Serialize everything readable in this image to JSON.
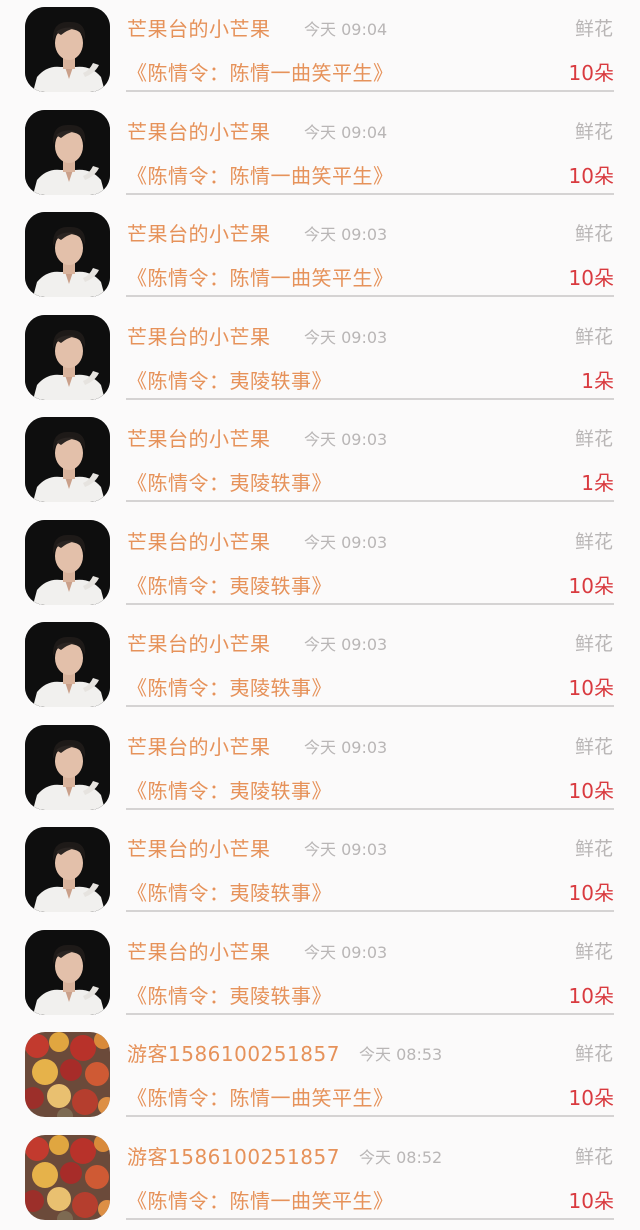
{
  "gift_records": [
    {
      "user": "芒果台的小芒果",
      "time": "今天 09:04",
      "gift": "鲜花",
      "show": "《陈情令：陈情一曲笑平生》",
      "count": "10朵",
      "avatar": "star-portrait-icon"
    },
    {
      "user": "芒果台的小芒果",
      "time": "今天 09:04",
      "gift": "鲜花",
      "show": "《陈情令：陈情一曲笑平生》",
      "count": "10朵",
      "avatar": "star-portrait-icon"
    },
    {
      "user": "芒果台的小芒果",
      "time": "今天 09:03",
      "gift": "鲜花",
      "show": "《陈情令：陈情一曲笑平生》",
      "count": "10朵",
      "avatar": "star-portrait-icon"
    },
    {
      "user": "芒果台的小芒果",
      "time": "今天 09:03",
      "gift": "鲜花",
      "show": "《陈情令：夷陵轶事》",
      "count": "1朵",
      "avatar": "star-portrait-icon"
    },
    {
      "user": "芒果台的小芒果",
      "time": "今天 09:03",
      "gift": "鲜花",
      "show": "《陈情令：夷陵轶事》",
      "count": "1朵",
      "avatar": "star-portrait-icon"
    },
    {
      "user": "芒果台的小芒果",
      "time": "今天 09:03",
      "gift": "鲜花",
      "show": "《陈情令：夷陵轶事》",
      "count": "10朵",
      "avatar": "star-portrait-icon"
    },
    {
      "user": "芒果台的小芒果",
      "time": "今天 09:03",
      "gift": "鲜花",
      "show": "《陈情令：夷陵轶事》",
      "count": "10朵",
      "avatar": "star-portrait-icon"
    },
    {
      "user": "芒果台的小芒果",
      "time": "今天 09:03",
      "gift": "鲜花",
      "show": "《陈情令：夷陵轶事》",
      "count": "10朵",
      "avatar": "star-portrait-icon"
    },
    {
      "user": "芒果台的小芒果",
      "time": "今天 09:03",
      "gift": "鲜花",
      "show": "《陈情令：夷陵轶事》",
      "count": "10朵",
      "avatar": "star-portrait-icon"
    },
    {
      "user": "芒果台的小芒果",
      "time": "今天 09:03",
      "gift": "鲜花",
      "show": "《陈情令：夷陵轶事》",
      "count": "10朵",
      "avatar": "star-portrait-icon"
    },
    {
      "user": "游客1586100251857",
      "time": "今天 08:53",
      "gift": "鲜花",
      "show": "《陈情令：陈情一曲笑平生》",
      "count": "10朵",
      "avatar": "autumn-leaves-icon"
    },
    {
      "user": "游客1586100251857",
      "time": "今天 08:52",
      "gift": "鲜花",
      "show": "《陈情令：陈情一曲笑平生》",
      "count": "10朵",
      "avatar": "autumn-leaves-icon"
    }
  ],
  "colors": {
    "accent_orange": "#e6925a",
    "count_red": "#d93a3f",
    "muted_gray": "#b9b6b6",
    "divider": "#d5d3d3",
    "background": "#fbfafa"
  }
}
